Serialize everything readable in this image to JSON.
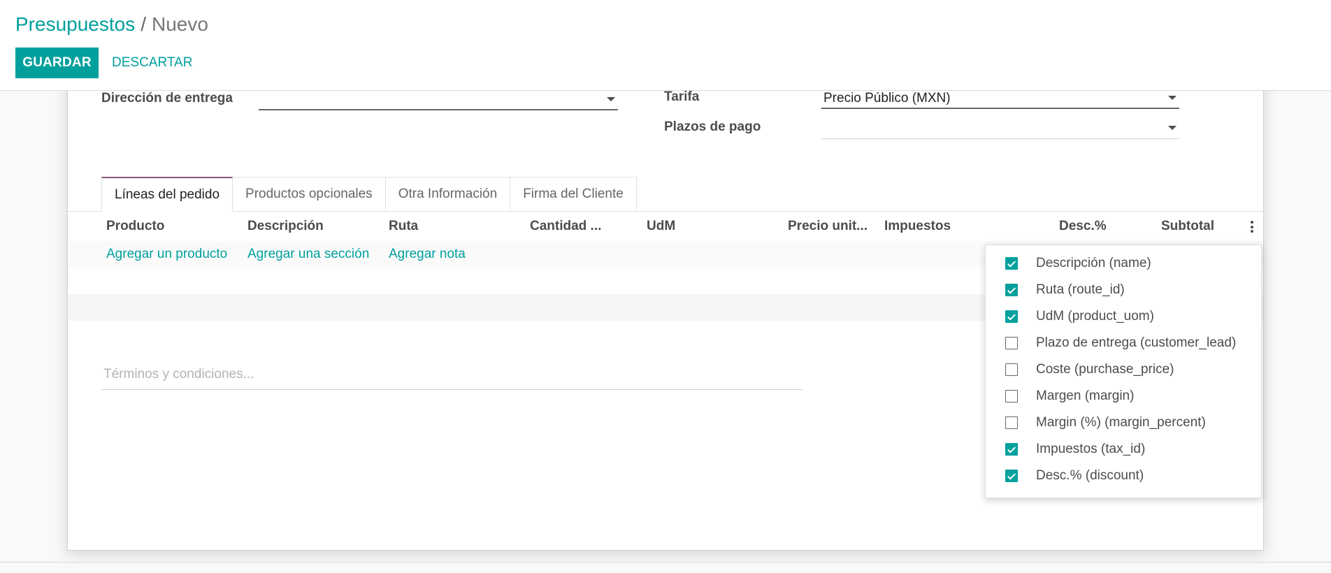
{
  "breadcrumb": {
    "parent": "Presupuestos",
    "separator": "/",
    "current": "Nuevo"
  },
  "buttons": {
    "save": "GUARDAR",
    "discard": "DESCARTAR"
  },
  "form": {
    "delivery_address": {
      "label": "Dirección de entrega",
      "value": ""
    },
    "pricelist": {
      "label": "Tarifa",
      "value": "Precio Público (MXN)"
    },
    "payment_terms": {
      "label": "Plazos de pago",
      "value": ""
    },
    "terms_placeholder": "Términos y condiciones..."
  },
  "tabs": [
    {
      "label": "Líneas del pedido",
      "active": true
    },
    {
      "label": "Productos opcionales",
      "active": false
    },
    {
      "label": "Otra Información",
      "active": false
    },
    {
      "label": "Firma del Cliente",
      "active": false
    }
  ],
  "table": {
    "columns": [
      "Producto",
      "Descripción",
      "Ruta",
      "Cantidad ...",
      "UdM",
      "Precio unit...",
      "Impuestos",
      "Desc.%",
      "Subtotal"
    ],
    "add_actions": [
      "Agregar un producto",
      "Agregar una sección",
      "Agregar nota"
    ]
  },
  "optional_columns": [
    {
      "label": "Descripción (name)",
      "checked": true
    },
    {
      "label": "Ruta (route_id)",
      "checked": true
    },
    {
      "label": "UdM (product_uom)",
      "checked": true
    },
    {
      "label": "Plazo de entrega (customer_lead)",
      "checked": false
    },
    {
      "label": "Coste (purchase_price)",
      "checked": false
    },
    {
      "label": "Margen (margin)",
      "checked": false
    },
    {
      "label": "Margin (%) (margin_percent)",
      "checked": false
    },
    {
      "label": "Impuestos (tax_id)",
      "checked": true
    },
    {
      "label": "Desc.% (discount)",
      "checked": true
    }
  ],
  "colors": {
    "accent": "#00a09d",
    "active_tab": "#875a7b"
  }
}
